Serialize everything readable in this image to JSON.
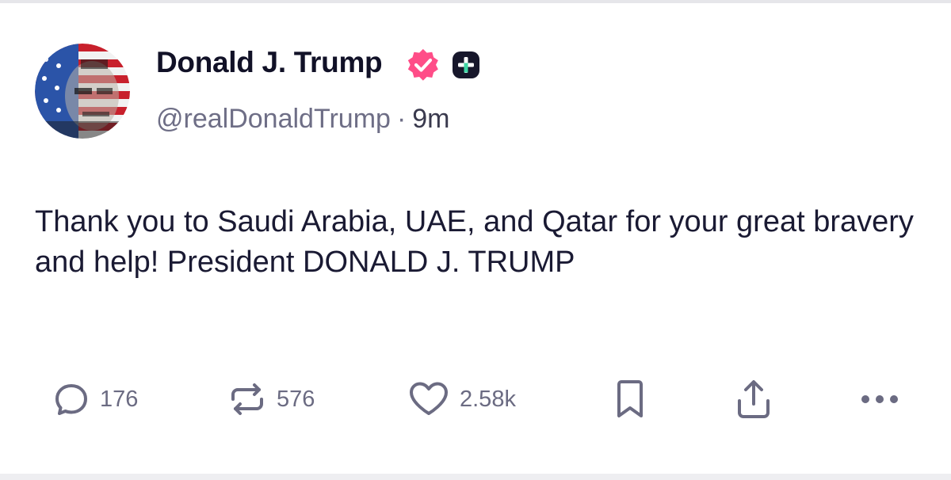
{
  "post": {
    "author": {
      "display_name": "Donald J. Trump",
      "handle": "@realDonaldTrump",
      "time_separator": "·",
      "time": "9m"
    },
    "text": "Thank you to Saudi Arabia, UAE, and Qatar for your great bravery and help! President DONALD J. TRUMP",
    "actions": {
      "replies": "176",
      "reposts": "576",
      "likes": "2.58k"
    }
  },
  "icons": {
    "verified": "verified-badge-icon",
    "plus": "plus-badge-icon",
    "reply": "reply-icon",
    "repost": "repost-icon",
    "like": "heart-icon",
    "bookmark": "bookmark-icon",
    "share": "share-icon",
    "more": "more-icon"
  },
  "colors": {
    "verified": "#ff4d88",
    "text": "#1a1a33",
    "secondary": "#6e6e86",
    "action": "#6b6b82"
  }
}
